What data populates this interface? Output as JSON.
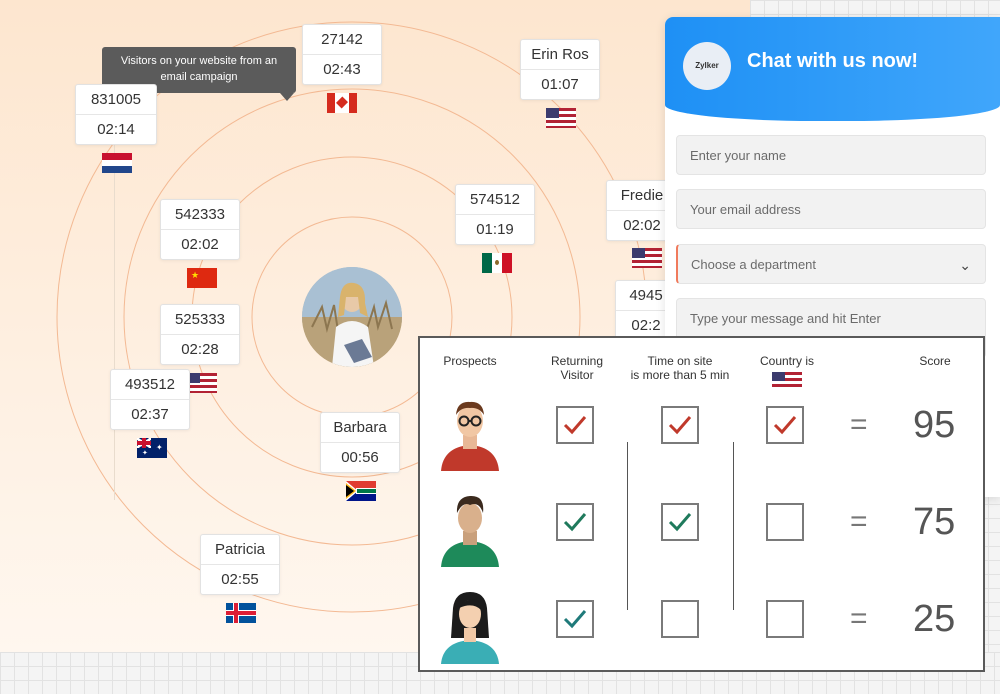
{
  "tooltip": {
    "text_line1": "Visitors on your website from an",
    "text_line2": "email campaign"
  },
  "visitors": [
    {
      "id_label": "831005",
      "time": "02:14",
      "country": "netherlands-flag-icon"
    },
    {
      "id_label": "27142",
      "time": "02:43",
      "country": "canada-flag-icon"
    },
    {
      "id_label": "Erin Ros",
      "time": "01:07",
      "country": "usa-flag-icon"
    },
    {
      "id_label": "Fredie",
      "time": "02:02",
      "country": "usa-flag-icon"
    },
    {
      "id_label": "574512",
      "time": "01:19",
      "country": "mexico-flag-icon"
    },
    {
      "id_label": "542333",
      "time": "02:02",
      "country": "china-flag-icon"
    },
    {
      "id_label": "4945",
      "time": "02:2",
      "country": ""
    },
    {
      "id_label": "525333",
      "time": "02:28",
      "country": "usa-flag-icon"
    },
    {
      "id_label": "493512",
      "time": "02:37",
      "country": "australia-flag-icon"
    },
    {
      "id_label": "Barbara",
      "time": "00:56",
      "country": "south-africa-flag-icon"
    },
    {
      "id_label": "Patricia",
      "time": "02:55",
      "country": "iceland-flag-icon"
    }
  ],
  "chat": {
    "logo_text": "Zylker",
    "title": "Chat with us now!",
    "name_placeholder": "Enter your name",
    "email_placeholder": "Your email address",
    "department_placeholder": "Choose a department",
    "message_placeholder": "Type your message and hit Enter"
  },
  "scoring": {
    "headers": {
      "prospects": "Prospects",
      "returning_line1": "Returning",
      "returning_line2": "Visitor",
      "time_line1": "Time on site",
      "time_line2": "is more than 5 min",
      "country": "Country is",
      "score": "Score"
    },
    "equals": "=",
    "rows": [
      {
        "returning": true,
        "time": true,
        "country": true,
        "score": "95",
        "check_color": "#c0392b"
      },
      {
        "returning": true,
        "time": true,
        "country": false,
        "score": "75",
        "check_color": "#1f7a5c"
      },
      {
        "returning": true,
        "time": false,
        "country": false,
        "score": "25",
        "check_color": "#1f7a7a"
      }
    ]
  },
  "colors": {
    "ring": "#f3b993",
    "chat_header": "#2196f3",
    "accent_check_red": "#c0392b",
    "accent_check_green": "#1f7a5c"
  }
}
